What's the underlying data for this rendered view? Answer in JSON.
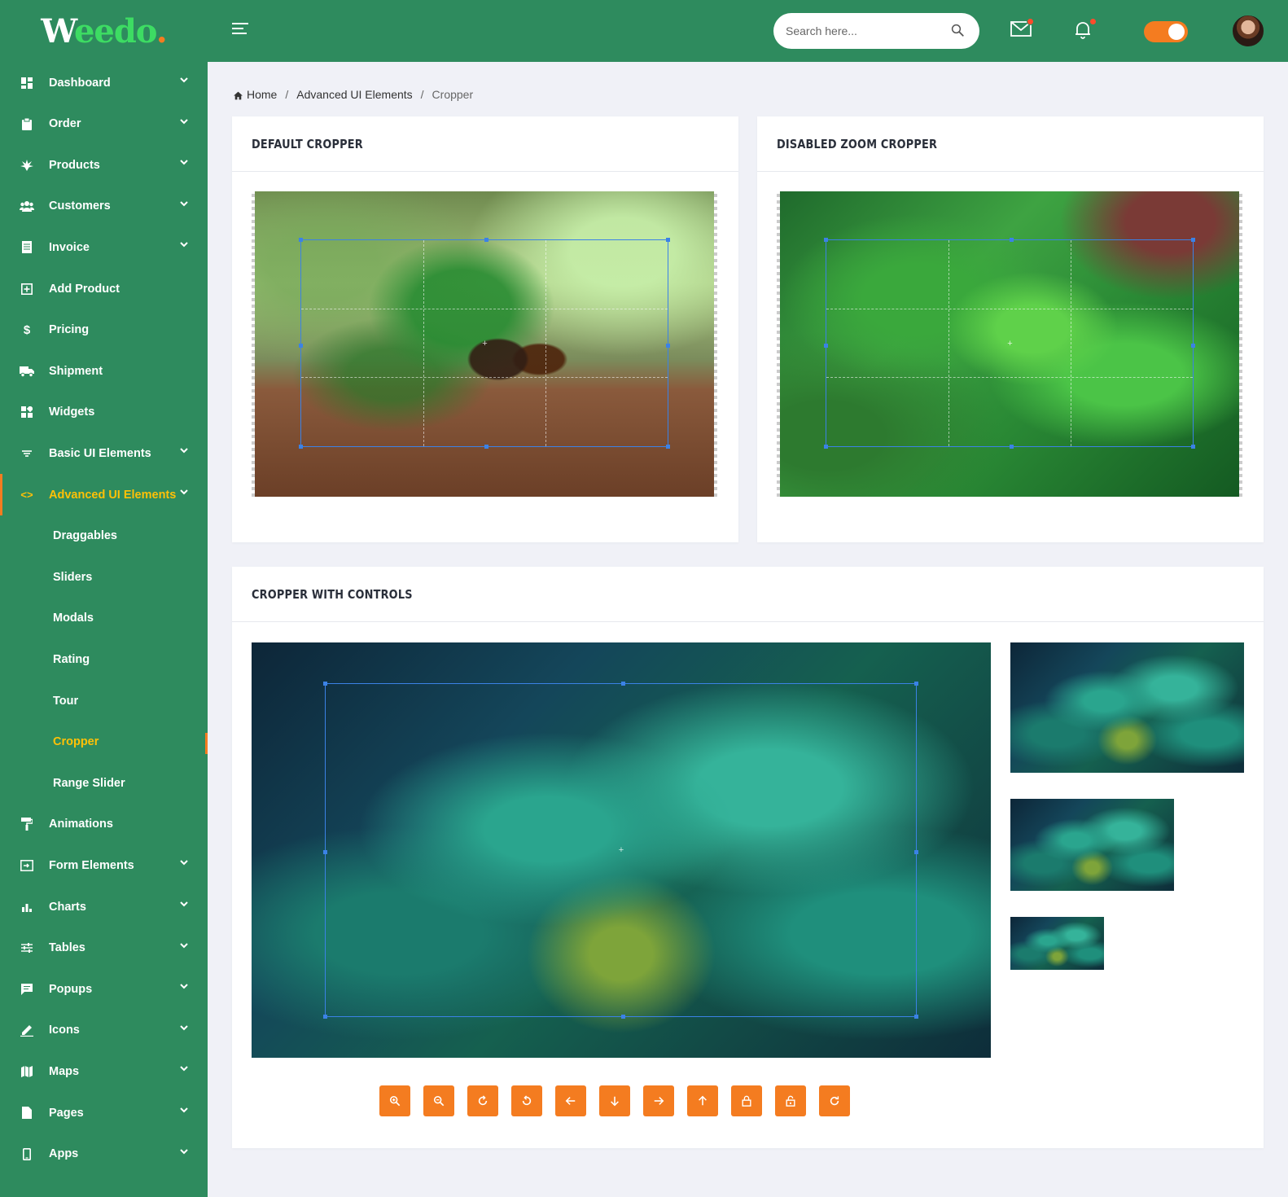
{
  "brand": {
    "logo_w": "W",
    "logo_rest": "eedo",
    "logo_dot": "."
  },
  "sidebar": {
    "items": [
      {
        "label": "Dashboard",
        "icon": "dashboard-icon",
        "chevron": true
      },
      {
        "label": "Order",
        "icon": "clipboard-icon",
        "chevron": true
      },
      {
        "label": "Products",
        "icon": "leaf-icon",
        "chevron": true
      },
      {
        "label": "Customers",
        "icon": "users-icon",
        "chevron": true
      },
      {
        "label": "Invoice",
        "icon": "invoice-icon",
        "chevron": true
      },
      {
        "label": "Add Product",
        "icon": "plus-square-icon",
        "chevron": false
      },
      {
        "label": "Pricing",
        "icon": "dollar-icon",
        "chevron": false
      },
      {
        "label": "Shipment",
        "icon": "truck-icon",
        "chevron": false
      },
      {
        "label": "Widgets",
        "icon": "widgets-icon",
        "chevron": false
      },
      {
        "label": "Basic UI Elements",
        "icon": "filter-icon",
        "chevron": true
      },
      {
        "label": "Advanced UI Elements",
        "icon": "code-icon",
        "chevron": true,
        "active": true
      }
    ],
    "sub_items": [
      "Draggables",
      "Sliders",
      "Modals",
      "Rating",
      "Tour",
      "Cropper",
      "Range Slider"
    ],
    "active_sub": "Cropper",
    "items_after": [
      {
        "label": "Animations",
        "icon": "paint-roller-icon",
        "chevron": false
      },
      {
        "label": "Form Elements",
        "icon": "form-icon",
        "chevron": true
      },
      {
        "label": "Charts",
        "icon": "bar-chart-icon",
        "chevron": true
      },
      {
        "label": "Tables",
        "icon": "sliders-icon",
        "chevron": true
      },
      {
        "label": "Popups",
        "icon": "message-icon",
        "chevron": true
      },
      {
        "label": "Icons",
        "icon": "pen-icon",
        "chevron": true
      },
      {
        "label": "Maps",
        "icon": "map-icon",
        "chevron": true
      },
      {
        "label": "Pages",
        "icon": "file-icon",
        "chevron": true
      },
      {
        "label": "Apps",
        "icon": "mobile-icon",
        "chevron": true
      }
    ]
  },
  "header": {
    "search_placeholder": "Search here...",
    "toggle_on": true
  },
  "breadcrumb": {
    "home": "Home",
    "parent": "Advanced UI Elements",
    "current": "Cropper",
    "sep": "/"
  },
  "cards": {
    "default_title": "DEFAULT CROPPER",
    "disabled_zoom_title": "DISABLED ZOOM CROPPER",
    "controls_title": "CROPPER WITH CONTROLS"
  },
  "controls": [
    {
      "name": "zoom-in-button",
      "icon": "zoom-in-icon"
    },
    {
      "name": "zoom-out-button",
      "icon": "zoom-out-icon"
    },
    {
      "name": "rotate-right-button",
      "icon": "rotate-right-icon"
    },
    {
      "name": "rotate-left-button",
      "icon": "rotate-left-icon"
    },
    {
      "name": "move-left-button",
      "icon": "arrow-left-icon"
    },
    {
      "name": "move-down-button",
      "icon": "arrow-down-icon"
    },
    {
      "name": "move-right-button",
      "icon": "arrow-right-icon"
    },
    {
      "name": "move-up-button",
      "icon": "arrow-up-icon"
    },
    {
      "name": "lock-button",
      "icon": "lock-icon"
    },
    {
      "name": "unlock-button",
      "icon": "unlock-icon"
    },
    {
      "name": "reset-button",
      "icon": "refresh-icon"
    }
  ],
  "colors": {
    "sidebar": "#2e8b5e",
    "accent": "#f47c20",
    "active_text": "#ffc107",
    "crop_border": "#3b82e6"
  }
}
